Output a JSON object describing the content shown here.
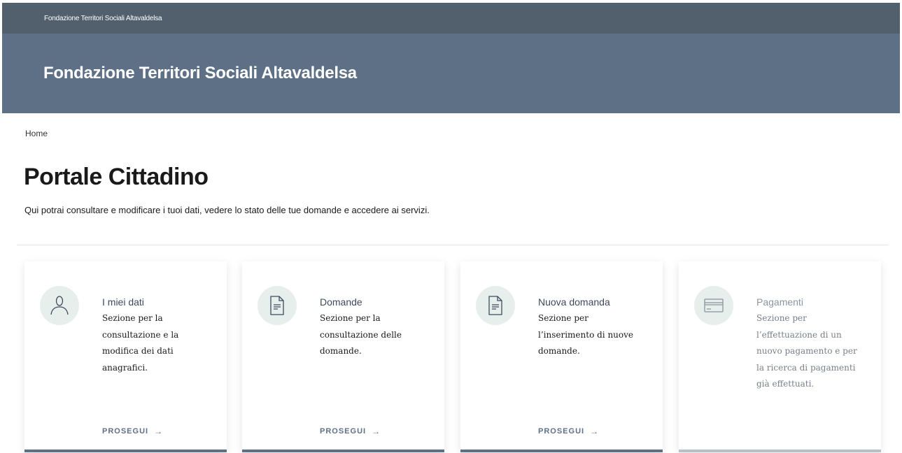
{
  "topbar": {
    "org_link": "Fondazione Territori Sociali Altavaldelsa"
  },
  "header": {
    "title": "Fondazione Territori Sociali Altavaldelsa"
  },
  "breadcrumb": {
    "home": "Home"
  },
  "page": {
    "title": "Portale Cittadino",
    "subtitle": "Qui potrai consultare e modificare i tuoi dati, vedere lo stato delle tue domande e accedere ai servizi."
  },
  "cards": [
    {
      "icon": "user-icon",
      "title": "I miei dati",
      "description": "Sezione per la consultazione e la modifica dei dati anagrafici.",
      "link": "PROSEGUI",
      "arrow": "→"
    },
    {
      "icon": "document-icon",
      "title": "Domande",
      "description": "Sezione per la consultazione delle domande.",
      "link": "PROSEGUI",
      "arrow": "→"
    },
    {
      "icon": "document-icon",
      "title": "Nuova domanda",
      "description": "Sezione per l’inserimento di nuove domande.",
      "link": "PROSEGUI",
      "arrow": "→"
    },
    {
      "icon": "credit-card-icon",
      "title": "Pagamenti",
      "description": "Sezione per l’effettuazione di un nuovo pagamento e per la ricerca di pagamenti già effettuati.",
      "disabled": true
    }
  ],
  "colors": {
    "topbar": "#525f6c",
    "header": "#5e7085",
    "accent": "#5e7085",
    "icon_bg": "#e7efec"
  }
}
